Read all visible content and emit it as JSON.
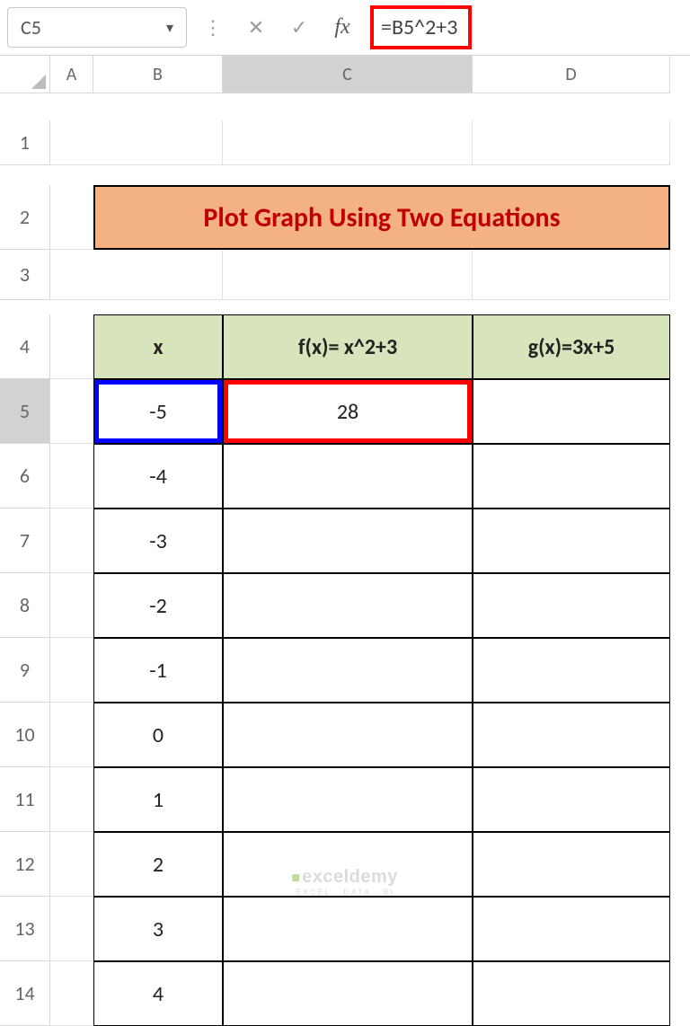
{
  "namebox": "C5",
  "formula": "=B5^2+3",
  "columns": [
    "A",
    "B",
    "C",
    "D"
  ],
  "rows": [
    "1",
    "2",
    "3",
    "4",
    "5",
    "6",
    "7",
    "8",
    "9",
    "10",
    "11",
    "12",
    "13",
    "14"
  ],
  "selected_col": "C",
  "selected_row": "5",
  "title": "Plot Graph Using Two Equations",
  "headers": {
    "x": "x",
    "fx": "f(x)= x^2+3",
    "gx": "g(x)=3x+5"
  },
  "xvals": [
    "-5",
    "-4",
    "-3",
    "-2",
    "-1",
    "0",
    "1",
    "2",
    "3",
    "4"
  ],
  "fx_first": "28",
  "watermark": {
    "brand": "exceldemy",
    "tag": "EXCEL · DATA · BI"
  }
}
